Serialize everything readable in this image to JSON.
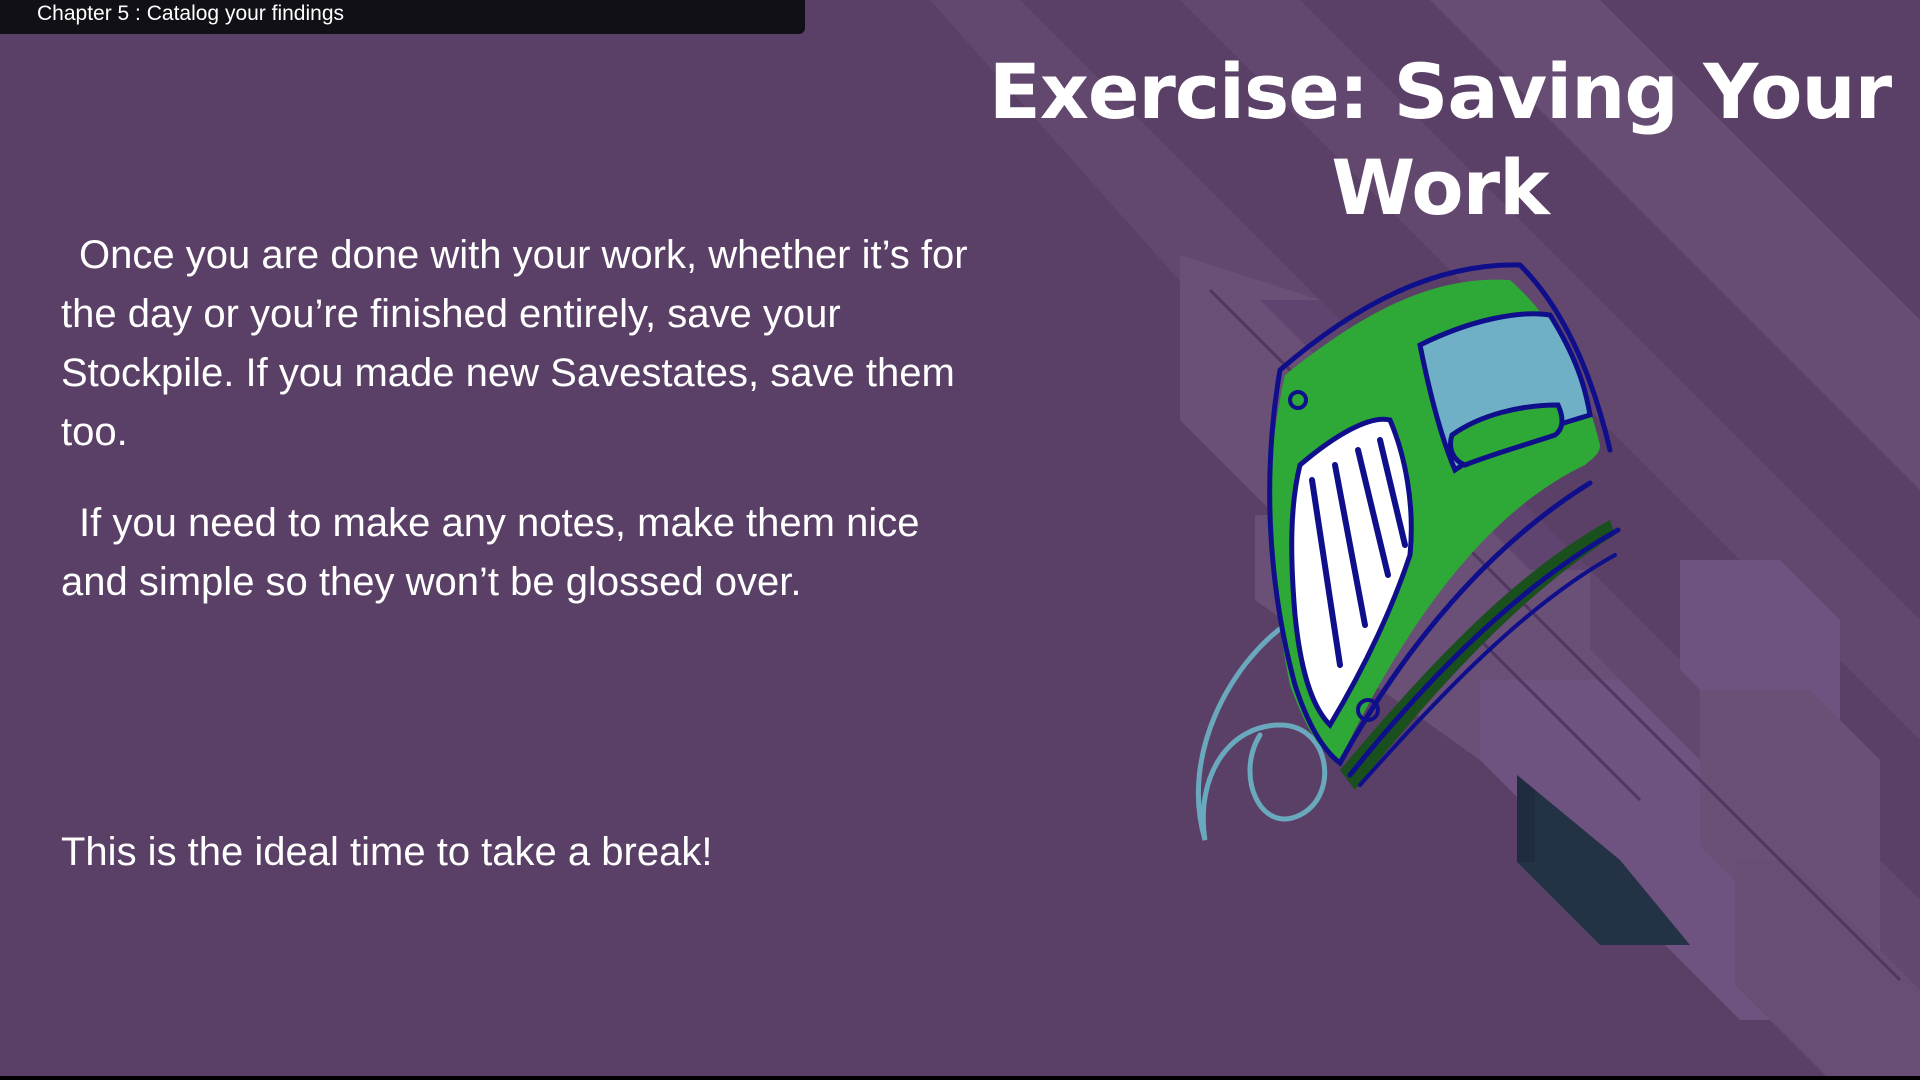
{
  "header": {
    "chapter_label": "Chapter 5 : Catalog your findings"
  },
  "slide": {
    "title": "Exercise: Saving Your Work",
    "paragraphs": [
      "Once you are done with your work, whether it’s for the day or you’re finished entirely, save your Stockpile.  If you made new Savestates, save them too.",
      "If you need to make any notes, make them nice and simple so they won’t be glossed over.",
      "This is the ideal time to take a break!"
    ],
    "illustration": "save-floppy-icon"
  },
  "colors": {
    "background": "#5a3f66",
    "stripe_light": "#6b4f78",
    "stripe_dark": "#243246",
    "floppy_green": "#2ea836",
    "floppy_outline": "#0f0f8c",
    "floppy_label": "#6fb0c6",
    "swirl": "#6aa8bd",
    "header_bar": "#111016",
    "text": "#ffffff"
  }
}
